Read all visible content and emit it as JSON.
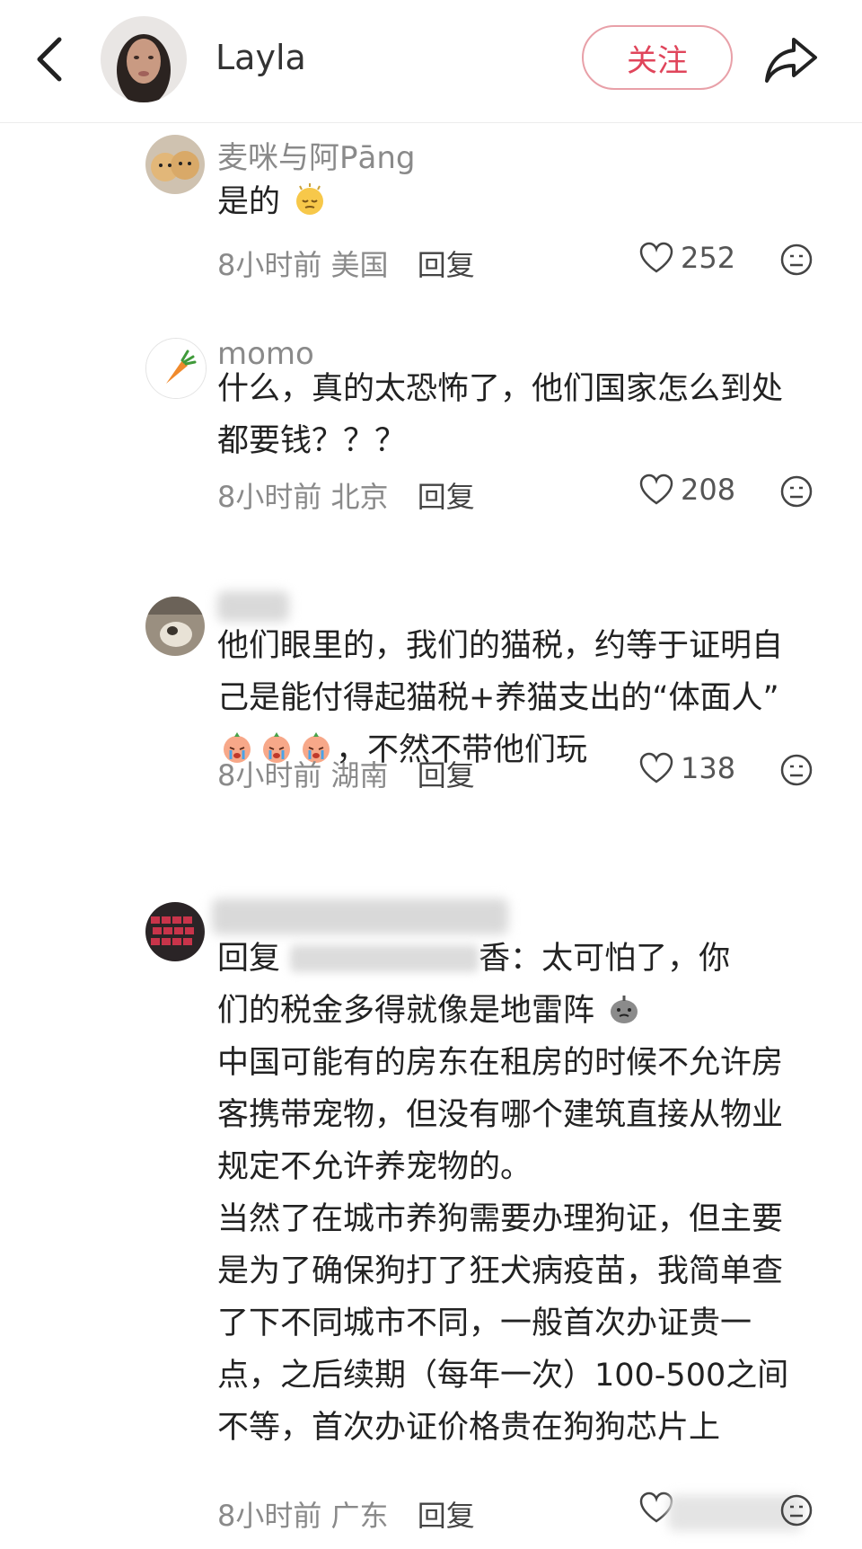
{
  "header": {
    "username": "Layla",
    "follow_label": "关注"
  },
  "comments": [
    {
      "user": "麦咪与阿Pāng",
      "text": "是的",
      "time": "8小时前",
      "location": "美国",
      "reply_label": "回复",
      "likes": "252"
    },
    {
      "user": "momo",
      "text_lines": [
        "什么，真的太恐怖了，他们国家怎么到处",
        "都要钱？？？"
      ],
      "time": "8小时前",
      "location": "北京",
      "reply_label": "回复",
      "likes": "208"
    },
    {
      "user": "",
      "text_lines": [
        "他们眼里的，我们的猫税，约等于证明自",
        "己是能付得起猫税+养猫支出的“体面人”"
      ],
      "text_tail": "，不然不带他们玩",
      "time": "8小时前",
      "location": "湖南",
      "reply_label": "回复",
      "likes": "138"
    },
    {
      "user": "",
      "reply_prefix": "回复",
      "reply_target_suffix": "香：",
      "first_line_rest": "太可怕了，你",
      "second_line": "们的税金多得就像是地雷阵",
      "text_lines": [
        "中国可能有的房东在租房的时候不允许房",
        "客携带宠物，但没有哪个建筑直接从物业",
        "规定不允许养宠物的。",
        "当然了在城市养狗需要办理狗证，但主要",
        "是为了确保狗打了狂犬病疫苗，我简单查",
        "了下不同城市不同，一般首次办证贵一",
        "点，之后续期（每年一次）100-500之间",
        "不等，首次办证价格贵在狗狗芯片上"
      ],
      "time": "8小时前",
      "location": "广东",
      "reply_label": "回复"
    }
  ],
  "colors": {
    "accent": "#e0455b",
    "secondary_text": "#8a8a8a",
    "body_text": "#222222"
  },
  "icons": [
    "back-arrow-icon",
    "share-icon",
    "heart-icon",
    "dislike-face-icon",
    "sleepy-emoji-icon",
    "crying-emoji-icon",
    "mine-emoji-icon"
  ]
}
